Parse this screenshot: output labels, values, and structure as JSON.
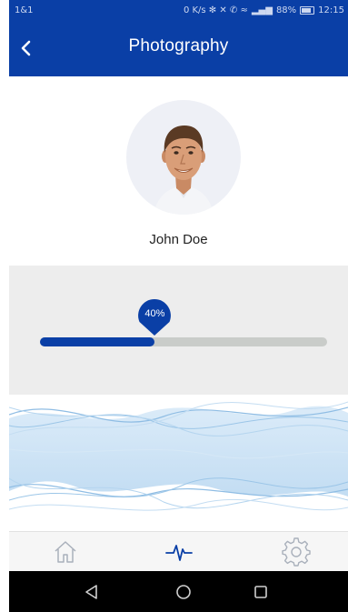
{
  "status_bar": {
    "carrier": "1&1",
    "indicators": "0 K/s ✻ ✕ ✆ ≈",
    "battery_percent": "88%",
    "time": "12:15"
  },
  "header": {
    "title": "Photography",
    "back_icon": "chevron-left-icon"
  },
  "profile": {
    "name": "John Doe",
    "avatar_icon": "user-photo"
  },
  "slider": {
    "label": "40%",
    "value": 0.4,
    "accent_color": "#0a3fa6",
    "track_color": "#c9ccc9"
  },
  "bottom_nav": {
    "items": [
      {
        "icon": "home-icon",
        "active": false
      },
      {
        "icon": "pulse-icon",
        "active": true
      },
      {
        "icon": "gear-icon",
        "active": false
      }
    ]
  },
  "system_nav": {
    "items": [
      "back-triangle-icon",
      "home-circle-icon",
      "recents-square-icon"
    ]
  },
  "colors": {
    "primary": "#0a3fa6",
    "wave": "#a9cdec"
  }
}
